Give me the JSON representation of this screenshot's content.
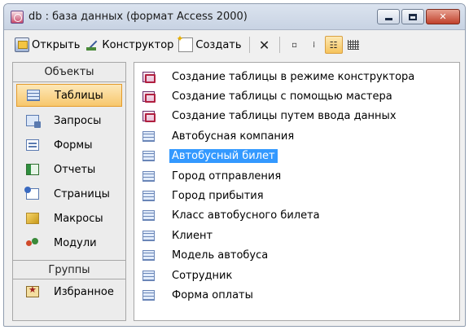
{
  "window": {
    "title": "db : база данных (формат Access 2000)"
  },
  "toolbar": {
    "open_label": "Открыть",
    "design_label": "Конструктор",
    "create_label": "Создать"
  },
  "sidebar": {
    "objects_header": "Объекты",
    "items": [
      {
        "label": "Таблицы",
        "icon": "table-icon"
      },
      {
        "label": "Запросы",
        "icon": "query-icon"
      },
      {
        "label": "Формы",
        "icon": "form-icon"
      },
      {
        "label": "Отчеты",
        "icon": "report-icon"
      },
      {
        "label": "Страницы",
        "icon": "page-icon"
      },
      {
        "label": "Макросы",
        "icon": "macro-icon"
      },
      {
        "label": "Модули",
        "icon": "module-icon"
      }
    ],
    "selected_index": 0,
    "groups_header": "Группы",
    "favorites_label": "Избранное"
  },
  "object_list": {
    "items": [
      {
        "label": "Создание таблицы в режиме конструктора",
        "icon": "wizard-icon"
      },
      {
        "label": "Создание таблицы с помощью мастера",
        "icon": "wizard-icon"
      },
      {
        "label": "Создание таблицы путем ввода данных",
        "icon": "wizard-icon"
      },
      {
        "label": "Автобусная компания",
        "icon": "table-icon"
      },
      {
        "label": "Автобусный билет",
        "icon": "table-icon"
      },
      {
        "label": "Город отправления",
        "icon": "table-icon"
      },
      {
        "label": "Город прибытия",
        "icon": "table-icon"
      },
      {
        "label": "Класс автобусного билета",
        "icon": "table-icon"
      },
      {
        "label": "Клиент",
        "icon": "table-icon"
      },
      {
        "label": "Модель автобуса",
        "icon": "table-icon"
      },
      {
        "label": "Сотрудник",
        "icon": "table-icon"
      },
      {
        "label": "Форма оплаты",
        "icon": "table-icon"
      }
    ],
    "selected_index": 4
  },
  "colors": {
    "selection_blue": "#3399ff",
    "nav_highlight": "#f7c76d"
  }
}
